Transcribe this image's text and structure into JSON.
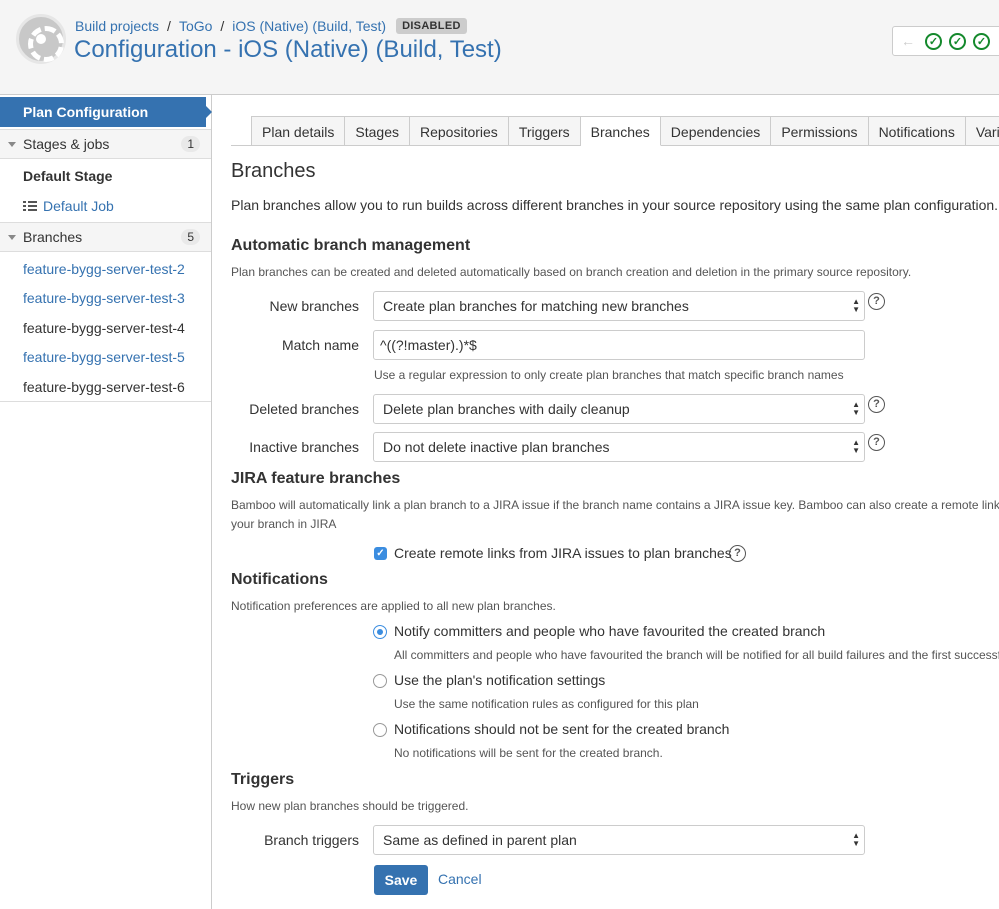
{
  "header": {
    "breadcrumbs": [
      "Build projects",
      "ToGo",
      "iOS (Native) (Build, Test)"
    ],
    "status_badge": "DISABLED",
    "title": "Configuration - iOS (Native) (Build, Test)",
    "nav_arrow": "←"
  },
  "sidebar": {
    "active_item": "Plan Configuration",
    "stages_group": {
      "label": "Stages & jobs",
      "count": "1"
    },
    "default_stage": "Default Stage",
    "default_job": "Default Job",
    "branches_group": {
      "label": "Branches",
      "count": "5"
    },
    "branches": [
      "feature-bygg-server-test-2",
      "feature-bygg-server-test-3",
      "feature-bygg-server-test-4",
      "feature-bygg-server-test-5",
      "feature-bygg-server-test-6"
    ]
  },
  "tabs": [
    "Plan details",
    "Stages",
    "Repositories",
    "Triggers",
    "Branches",
    "Dependencies",
    "Permissions",
    "Notifications",
    "Variab"
  ],
  "active_tab": "Branches",
  "main": {
    "heading": "Branches",
    "description": "Plan branches allow you to run builds across different branches in your source repository using the same plan configuration.",
    "auto": {
      "heading": "Automatic branch management",
      "description": "Plan branches can be created and deleted automatically based on branch creation and deletion in the primary source repository.",
      "new_branches_label": "New branches",
      "new_branches_value": "Create plan branches for matching new branches",
      "match_name_label": "Match name",
      "match_name_value": "^((?!master).)*$",
      "match_name_hint": "Use a regular expression to only create plan branches that match specific branch names",
      "deleted_label": "Deleted branches",
      "deleted_value": "Delete plan branches with daily cleanup",
      "inactive_label": "Inactive branches",
      "inactive_value": "Do not delete inactive plan branches"
    },
    "jira": {
      "heading": "JIRA feature branches",
      "description_line1": "Bamboo will automatically link a plan branch to a JIRA issue if the branch name contains a JIRA issue key. Bamboo can also create a remote link fro",
      "description_line2": "your branch in JIRA",
      "checkbox_label": "Create remote links from JIRA issues to plan branches"
    },
    "notifications": {
      "heading": "Notifications",
      "description": "Notification preferences are applied to all new plan branches.",
      "options": [
        {
          "label": "Notify committers and people who have favourited the created branch",
          "hint": "All committers and people who have favourited the branch will be notified for all build failures and the first successful"
        },
        {
          "label": "Use the plan's notification settings",
          "hint": "Use the same notification rules as configured for this plan"
        },
        {
          "label": "Notifications should not be sent for the created branch",
          "hint": "No notifications will be sent for the created branch."
        }
      ]
    },
    "triggers": {
      "heading": "Triggers",
      "description": "How new plan branches should be triggered.",
      "label": "Branch triggers",
      "value": "Same as defined in parent plan"
    },
    "save_label": "Save",
    "cancel_label": "Cancel"
  },
  "icons": {
    "help": "?",
    "check": "✓",
    "select_arrows": "▲▼"
  }
}
